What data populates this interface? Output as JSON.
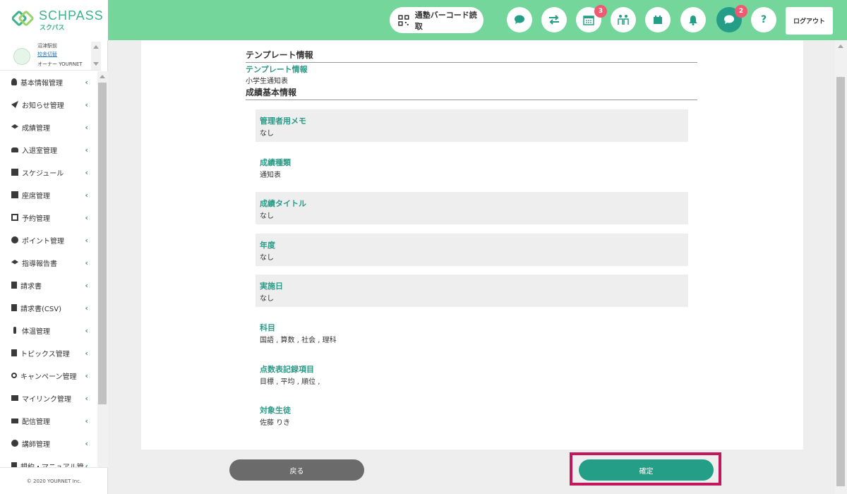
{
  "brand": {
    "name": "SCHPASS",
    "sub": "スクパス",
    "accent": "#74d69b",
    "primary": "#249e87",
    "label_color": "#2a9a86"
  },
  "header": {
    "qr_button": "通塾バーコード読取",
    "icons": [
      {
        "name": "chat-icon"
      },
      {
        "name": "transfer-icon"
      },
      {
        "name": "calendar-icon",
        "badge": "3"
      },
      {
        "name": "family-icon"
      },
      {
        "name": "event-icon"
      },
      {
        "name": "bell-icon"
      },
      {
        "name": "message-icon",
        "badge": "2",
        "active": true
      },
      {
        "name": "help-icon",
        "label": "?"
      }
    ],
    "logout": "ログアウト"
  },
  "sidebar": {
    "user": {
      "school": "沼津駅前",
      "switch": "校舎切替",
      "role": "オーナー YOURNET"
    },
    "items": [
      {
        "label": "基本情報管理",
        "icon": "user-icon"
      },
      {
        "label": "お知らせ管理",
        "icon": "send-icon"
      },
      {
        "label": "成績管理",
        "icon": "graduation-icon"
      },
      {
        "label": "入退室管理",
        "icon": "car-icon"
      },
      {
        "label": "スケジュール",
        "icon": "calendar-check-icon"
      },
      {
        "label": "座席管理",
        "icon": "grid-calendar-icon"
      },
      {
        "label": "予約管理",
        "icon": "reserve-icon"
      },
      {
        "label": "ポイント管理",
        "icon": "point-icon"
      },
      {
        "label": "指導報告書",
        "icon": "graduation-icon"
      },
      {
        "label": "請求書",
        "icon": "invoice-icon"
      },
      {
        "label": "請求書(CSV)",
        "icon": "invoice-icon"
      },
      {
        "label": "体温管理",
        "icon": "thermometer-icon"
      },
      {
        "label": "トピックス管理",
        "icon": "book-icon"
      },
      {
        "label": "キャンペーン管理",
        "icon": "award-icon"
      },
      {
        "label": "マイリンク管理",
        "icon": "id-card-icon"
      },
      {
        "label": "配信管理",
        "icon": "video-icon"
      },
      {
        "label": "講師管理",
        "icon": "teacher-icon"
      },
      {
        "label": "規約・マニュアル管",
        "icon": "book-icon"
      }
    ],
    "footer": "© 2020 YOURNET Inc."
  },
  "main": {
    "section1_title": "テンプレート情報",
    "template_label": "テンプレート情報",
    "template_value": "小学生通知表",
    "section2_title": "成績基本情報",
    "fields": [
      {
        "label": "管理者用メモ",
        "value": "なし"
      },
      {
        "label": "成績種類",
        "value": "通知表"
      },
      {
        "label": "成績タイトル",
        "value": "なし"
      },
      {
        "label": "年度",
        "value": "なし"
      },
      {
        "label": "実施日",
        "value": "なし"
      },
      {
        "label": "科目",
        "value": "国語 , 算数 , 社会 , 理科"
      },
      {
        "label": "点数表記録項目",
        "value": "目標 , 平均 , 順位 ,"
      },
      {
        "label": "対象生徒",
        "value": "佐藤 りき"
      }
    ]
  },
  "buttons": {
    "back": "戻る",
    "confirm": "確定"
  }
}
